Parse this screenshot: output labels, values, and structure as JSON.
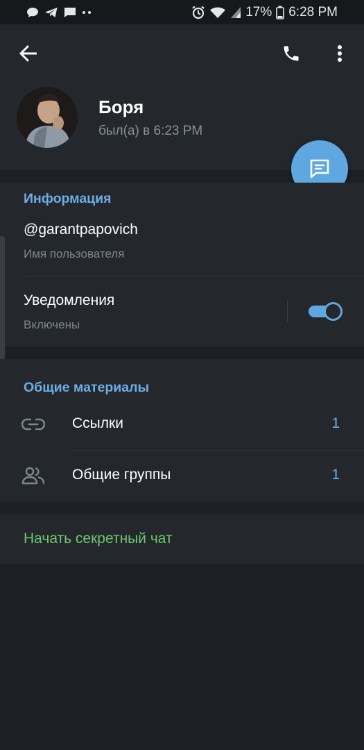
{
  "status_bar": {
    "battery": "17%",
    "time": "6:28 PM",
    "icons": [
      "chat-bubble-icon",
      "telegram-icon",
      "message-icon",
      "more-dots-icon",
      "alarm-icon",
      "wifi-icon",
      "signal-icon",
      "battery-icon"
    ]
  },
  "header": {
    "back_icon": "arrow-left-icon",
    "call_icon": "phone-icon",
    "more_icon": "more-vertical-icon"
  },
  "profile": {
    "name": "Боря",
    "status": "был(а) в 6:23 PM"
  },
  "fab": {
    "icon": "chat-message-icon",
    "color": "#5fa7e0"
  },
  "info": {
    "title": "Информация",
    "username": "@garantpapovich",
    "username_label": "Имя пользователя",
    "notifications_label": "Уведомления",
    "notifications_state": "Включены",
    "notifications_enabled": true
  },
  "shared_media": {
    "title": "Общие материалы",
    "items": [
      {
        "icon": "link-icon",
        "label": "Ссылки",
        "count": "1"
      },
      {
        "icon": "group-icon",
        "label": "Общие группы",
        "count": "1"
      }
    ]
  },
  "secret_chat": {
    "label": "Начать секретный чат",
    "color": "#6ec86e"
  },
  "colors": {
    "background": "#1d2024",
    "panel": "#24282d",
    "accent": "#5fa7e0",
    "secret": "#6ec86e"
  }
}
